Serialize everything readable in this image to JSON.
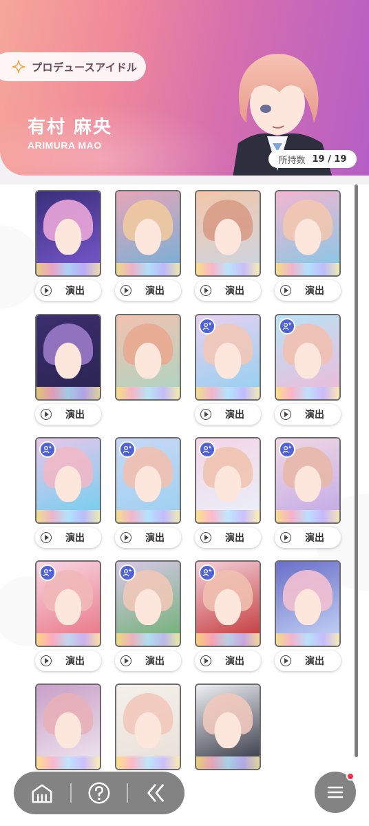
{
  "header": {
    "produce_label": "プロデュースアイドル",
    "name_jp": "有村 麻央",
    "name_en": "ARIMURA MAO",
    "count_label": "所持数",
    "count_value": "19 / 19"
  },
  "colors": {
    "header_start": "#f6a79a",
    "header_end": "#b45ec6",
    "badge": "#4f62d8",
    "notification": "#ff2a4a",
    "nav_bg": "#7a7a7a"
  },
  "cards": [
    {
      "has_badge": false,
      "has_perform": true
    },
    {
      "has_badge": false,
      "has_perform": true
    },
    {
      "has_badge": false,
      "has_perform": true
    },
    {
      "has_badge": false,
      "has_perform": true
    },
    {
      "has_badge": false,
      "has_perform": true
    },
    {
      "has_badge": false,
      "has_perform": false
    },
    {
      "has_badge": true,
      "has_perform": true
    },
    {
      "has_badge": true,
      "has_perform": true
    },
    {
      "has_badge": true,
      "has_perform": true
    },
    {
      "has_badge": true,
      "has_perform": true
    },
    {
      "has_badge": true,
      "has_perform": true
    },
    {
      "has_badge": true,
      "has_perform": true
    },
    {
      "has_badge": true,
      "has_perform": true
    },
    {
      "has_badge": true,
      "has_perform": true
    },
    {
      "has_badge": true,
      "has_perform": true
    },
    {
      "has_badge": false,
      "has_perform": true
    },
    {
      "has_badge": false,
      "has_perform": false
    },
    {
      "has_badge": false,
      "has_perform": false
    },
    {
      "has_badge": false,
      "has_perform": false
    }
  ],
  "perform_label": "演出",
  "nav": {
    "home_icon": "home-icon",
    "help_icon": "help-icon",
    "back_icon": "back-icon",
    "menu_icon": "menu-icon"
  }
}
